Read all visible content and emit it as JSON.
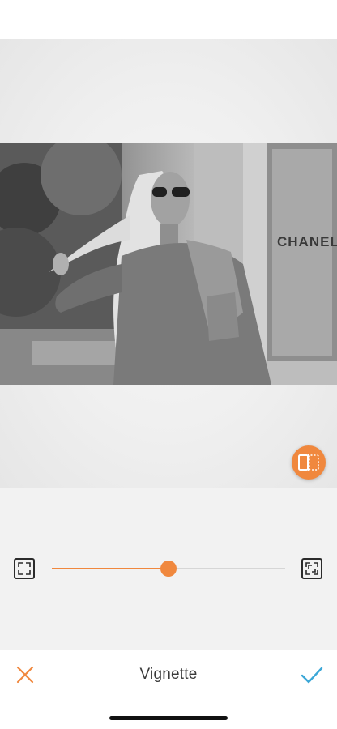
{
  "editor": {
    "tool_title": "Vignette",
    "cancel_icon": "close-icon",
    "confirm_icon": "check-icon",
    "compare_icon": "compare-icon"
  },
  "photo": {
    "sign_text": "CHANEL",
    "style": "black-and-white portrait photo"
  },
  "slider": {
    "value_fraction": 0.5,
    "left_icon": "frame-corners-icon",
    "right_icon": "frame-corners-icon"
  },
  "colors": {
    "accent": "#f0883e",
    "confirm": "#3ba7d7",
    "icon_dark": "#2b2b2b"
  }
}
